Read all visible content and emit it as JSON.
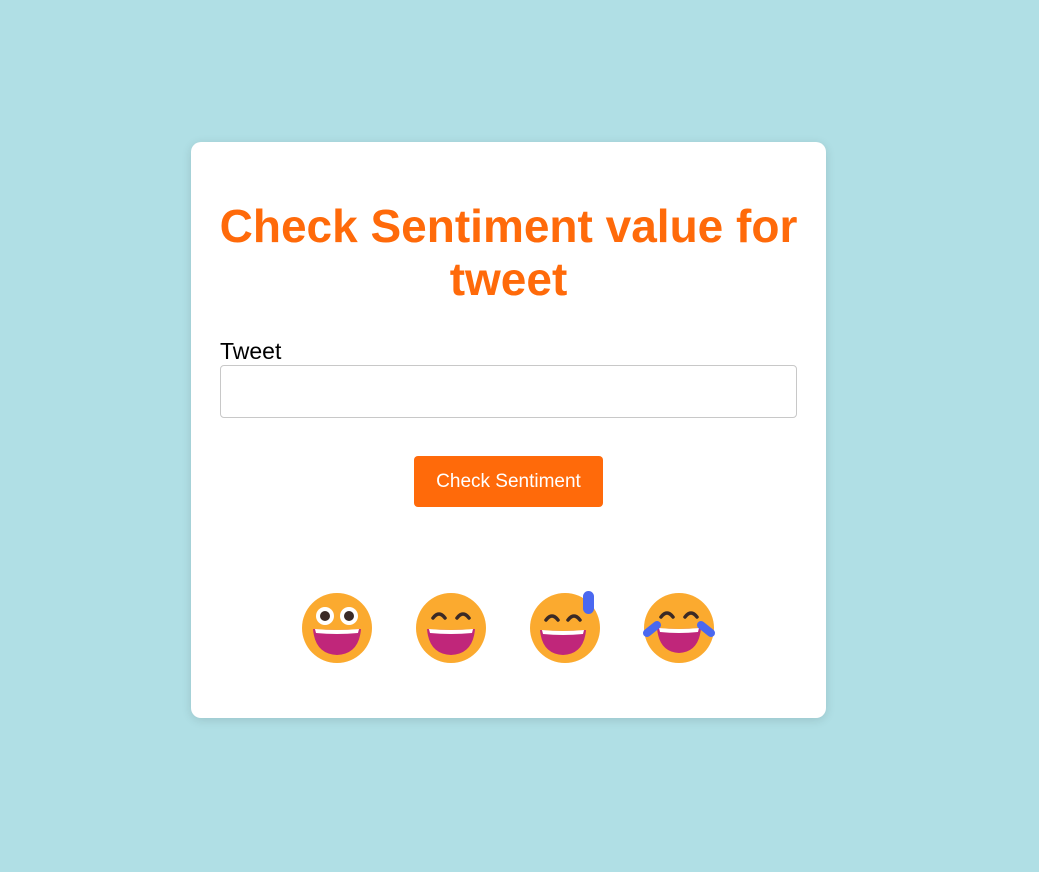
{
  "title": "Check Sentiment value for tweet",
  "form": {
    "label": "Tweet",
    "value": "",
    "placeholder": ""
  },
  "button": {
    "label": "Check Sentiment"
  },
  "emojis": [
    {
      "icon": "grinning-face-big-eyes-icon"
    },
    {
      "icon": "grinning-face-smiling-eyes-icon"
    },
    {
      "icon": "grinning-face-sweat-icon"
    },
    {
      "icon": "face-tears-of-joy-icon"
    }
  ],
  "colors": {
    "background": "#b0dfe5",
    "card": "#ffffff",
    "accent": "#ff6a0a",
    "emoji_face": "#fbaa2f",
    "emoji_mouth": "#c0267a",
    "emoji_tear": "#4a68f0"
  }
}
